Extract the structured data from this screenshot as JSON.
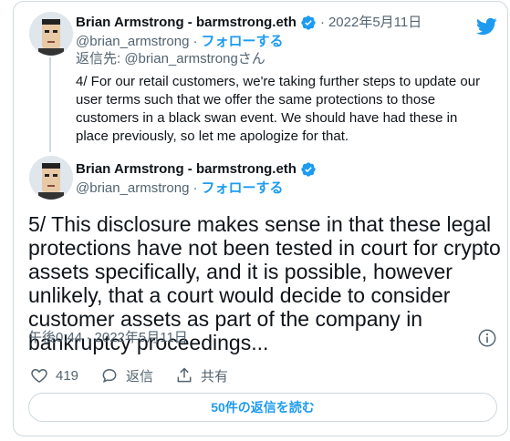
{
  "tweet1": {
    "author_name": "Brian Armstrong - barmstrong.eth",
    "separator": "·",
    "date": "2022年5月11日",
    "handle": "@brian_armstrong",
    "handle_sep": "·",
    "follow_label": "フォローする",
    "reply_to": "返信先: @brian_armstrongさん",
    "text": "4/ For our retail customers, we're taking further steps to update our user terms such that we offer the same protections to those customers in a black swan event. We should have had these in place previously, so let me apologize for that."
  },
  "tweet2": {
    "author_name": "Brian Armstrong - barmstrong.eth",
    "handle": "@brian_armstrong",
    "handle_sep": "·",
    "follow_label": "フォローする",
    "text": "5/ This disclosure makes sense in that these legal protections have not been tested in court for crypto assets specifically, and it is possible, however unlikely, that a court would decide to consider customer assets as part of the company in bankruptcy proceedings...",
    "timestamp": "午後0:44 · 2022年5月11日"
  },
  "actions": {
    "like_count": "419",
    "reply_label": "返信",
    "share_label": "共有"
  },
  "read_replies_label": "50件の返信を読む",
  "colors": {
    "accent": "#1d9bf0",
    "muted": "#536471",
    "border": "#cfd9de"
  },
  "icons": [
    "twitter-bird-icon",
    "verified-badge-icon",
    "info-icon",
    "heart-icon",
    "reply-bubble-icon",
    "share-icon"
  ]
}
